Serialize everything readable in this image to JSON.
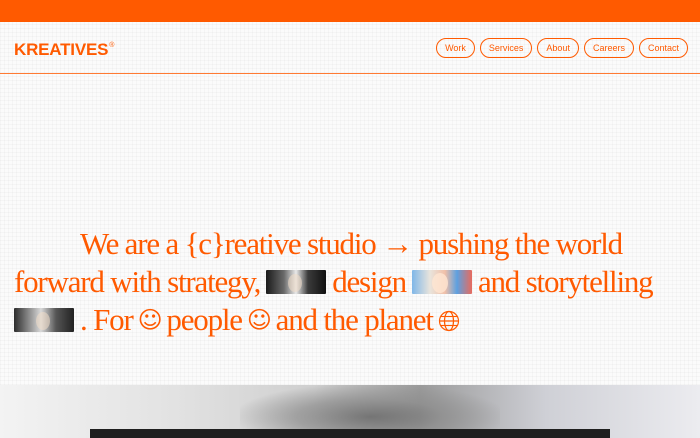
{
  "brand": {
    "name": "KREATIVES",
    "mark": "®"
  },
  "nav": [
    {
      "label": "Work"
    },
    {
      "label": "Services"
    },
    {
      "label": "About"
    },
    {
      "label": "Careers"
    },
    {
      "label": "Contact"
    }
  ],
  "hero": {
    "line1": "We are a {c}reative studio → pushing the world",
    "line2_a": "forward with strategy,",
    "line2_b": "design",
    "line2_c": "and storytelling",
    "line3_a": ". For",
    "line3_b": "people",
    "line3_c": "and the planet"
  },
  "icons": {
    "smiley_1": "smiley-icon",
    "smiley_2": "smiley-icon",
    "globe": "globe-icon"
  },
  "colors": {
    "accent": "#ff5a00",
    "background": "#fbfbfb"
  }
}
